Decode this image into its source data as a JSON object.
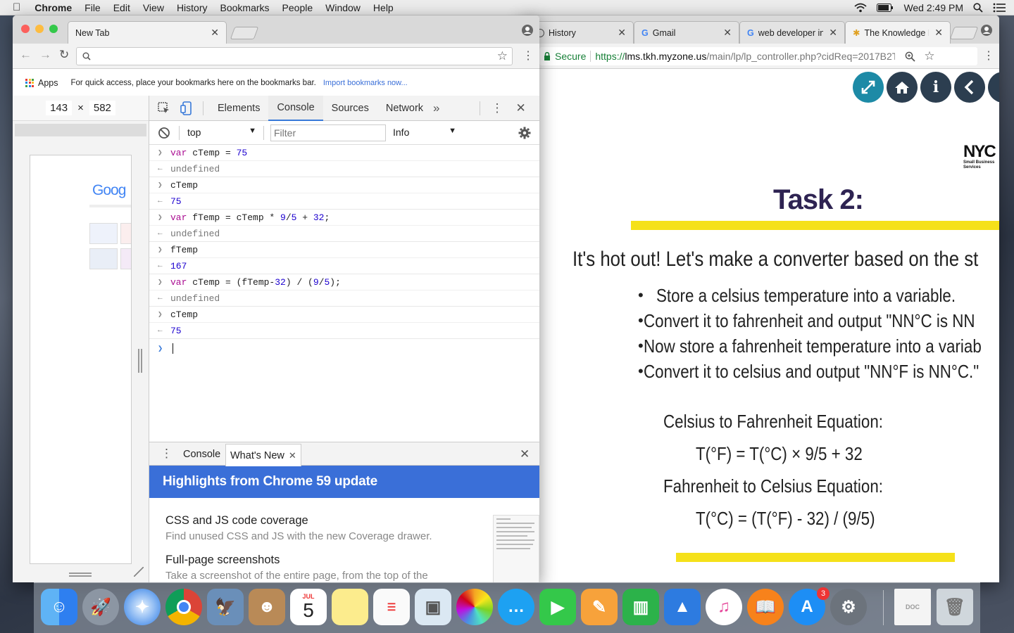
{
  "menubar": {
    "app": "Chrome",
    "items": [
      "File",
      "Edit",
      "View",
      "History",
      "Bookmarks",
      "People",
      "Window",
      "Help"
    ],
    "clock": "Wed 2:49 PM"
  },
  "left_window": {
    "tab_title": "New Tab",
    "bookmarks": {
      "apps_label": "Apps",
      "hint": "For quick access, place your bookmarks here on the bookmarks bar.",
      "import_link": "Import bookmarks now..."
    },
    "device": {
      "width": "143",
      "times": "×",
      "height": "582"
    },
    "preview_logo": "Goog"
  },
  "devtools": {
    "tabs": [
      "Elements",
      "Console",
      "Sources",
      "Network"
    ],
    "more": "»",
    "context": "top",
    "filter_placeholder": "Filter",
    "level": "Info",
    "console": [
      {
        "kind": "in",
        "parts": [
          {
            "c": "kw",
            "t": "var"
          },
          {
            "c": "",
            "t": " cTemp = "
          },
          {
            "c": "num",
            "t": "75"
          }
        ]
      },
      {
        "kind": "out",
        "parts": [
          {
            "c": "undef",
            "t": "undefined"
          }
        ]
      },
      {
        "kind": "in",
        "parts": [
          {
            "c": "",
            "t": "cTemp"
          }
        ]
      },
      {
        "kind": "out",
        "parts": [
          {
            "c": "num",
            "t": "75"
          }
        ]
      },
      {
        "kind": "in",
        "parts": [
          {
            "c": "kw",
            "t": "var"
          },
          {
            "c": "",
            "t": " fTemp = cTemp * "
          },
          {
            "c": "num",
            "t": "9"
          },
          {
            "c": "",
            "t": "/"
          },
          {
            "c": "num",
            "t": "5"
          },
          {
            "c": "",
            "t": " + "
          },
          {
            "c": "num",
            "t": "32"
          },
          {
            "c": "",
            "t": ";"
          }
        ]
      },
      {
        "kind": "out",
        "parts": [
          {
            "c": "undef",
            "t": "undefined"
          }
        ]
      },
      {
        "kind": "in",
        "parts": [
          {
            "c": "",
            "t": "fTemp"
          }
        ]
      },
      {
        "kind": "out",
        "parts": [
          {
            "c": "num",
            "t": "167"
          }
        ]
      },
      {
        "kind": "in",
        "parts": [
          {
            "c": "kw",
            "t": "var"
          },
          {
            "c": "",
            "t": " cTemp = (fTemp-"
          },
          {
            "c": "num",
            "t": "32"
          },
          {
            "c": "",
            "t": ") / ("
          },
          {
            "c": "num",
            "t": "9"
          },
          {
            "c": "",
            "t": "/"
          },
          {
            "c": "num",
            "t": "5"
          },
          {
            "c": "",
            "t": ");"
          }
        ]
      },
      {
        "kind": "out",
        "parts": [
          {
            "c": "undef",
            "t": "undefined"
          }
        ]
      },
      {
        "kind": "in",
        "parts": [
          {
            "c": "",
            "t": "cTemp"
          }
        ]
      },
      {
        "kind": "out",
        "parts": [
          {
            "c": "num",
            "t": "75"
          }
        ]
      }
    ],
    "drawer": {
      "tabs": [
        "Console",
        "What's New"
      ],
      "banner": "Highlights from Chrome 59 update",
      "items": [
        {
          "title": "CSS and JS code coverage",
          "desc": "Find unused CSS and JS with the new Coverage drawer."
        },
        {
          "title": "Full-page screenshots",
          "desc": "Take a screenshot of the entire page, from the top of the"
        }
      ]
    }
  },
  "right_window": {
    "tabs": [
      "History",
      "Gmail",
      "web developer in",
      "The Knowledge H"
    ],
    "secure_label": "Secure",
    "url_scheme": "https://",
    "url_host": "lms.tkh.myzone.us",
    "url_path": "/main/lp/lp_controller.php?cidReq=2017B2T...",
    "logo": {
      "main": "NYC",
      "sub": "Small Business Services"
    },
    "slide": {
      "title": "Task 2:",
      "intro": "It's hot out! Let's make a converter based on the st",
      "bullets": [
        "Store a celsius temperature into a variable.",
        "Convert it to fahrenheit and output \"NN°C is NN",
        "Now store a fahrenheit temperature into a variab",
        "Convert it to celsius and output \"NN°F is NN°C.\""
      ],
      "eq1_label": "Celsius to Fahrenheit Equation:",
      "eq1": "T(°F) = T(°C) × 9/5 + 32",
      "eq2_label": "Fahrenheit to Celsius Equation:",
      "eq2": "T(°C) = (T(°F) - 32) / (9/5)"
    }
  },
  "dock": {
    "calendar_month": "JUL",
    "calendar_day": "5",
    "appstore_badge": "3"
  },
  "colors": {
    "accent": "#3a6fd8",
    "slide_yellow": "#f5e11a",
    "nav_teal": "#1d8aa6",
    "nav_dark": "#2c3e50"
  }
}
